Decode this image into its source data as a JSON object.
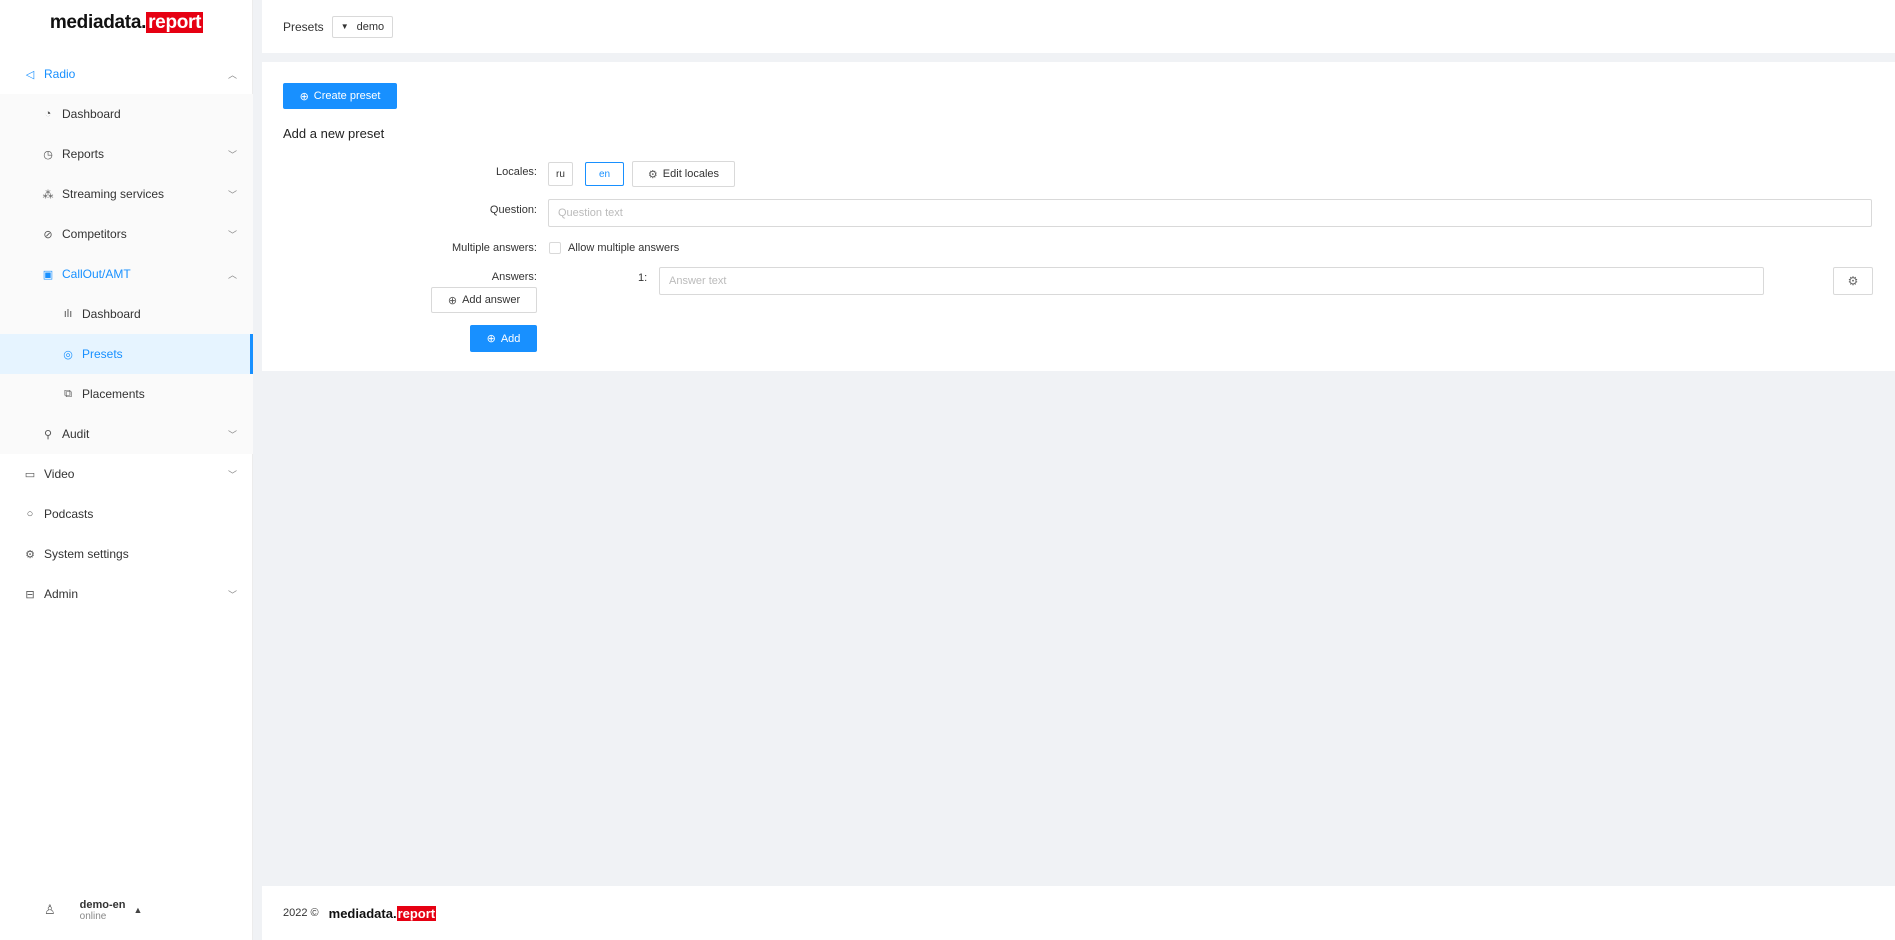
{
  "brand": {
    "name": "mediadata.",
    "highlight": "report"
  },
  "sidebar": {
    "radio": "Radio",
    "radio_dashboard": "Dashboard",
    "reports": "Reports",
    "streaming": "Streaming services",
    "competitors": "Competitors",
    "callout": "CallOut/AMT",
    "callout_dashboard": "Dashboard",
    "presets": "Presets",
    "placements": "Placements",
    "audit": "Audit",
    "video": "Video",
    "podcasts": "Podcasts",
    "system_settings": "System settings",
    "admin": "Admin"
  },
  "user": {
    "name": "demo-en",
    "status": "online"
  },
  "header": {
    "crumb": "Presets",
    "select_value": "demo"
  },
  "form": {
    "create_preset": "Create preset",
    "title": "Add a new preset",
    "locales_label": "Locales:",
    "locales": [
      "ru",
      "en"
    ],
    "active_locale": "en",
    "edit_locales": "Edit locales",
    "question_label": "Question:",
    "question_placeholder": "Question text",
    "multiple_label": "Multiple answers:",
    "allow_multiple": "Allow multiple answers",
    "answers_label": "Answers:",
    "answer_index": "1:",
    "answer_placeholder": "Answer text",
    "add_answer": "Add answer",
    "add": "Add"
  },
  "footer": {
    "year": "2022 ©",
    "brand": "mediadata.",
    "highlight": "report"
  },
  "colors": {
    "accent": "#1890ff",
    "brand_red": "#e60012",
    "background": "#f0f2f5"
  }
}
